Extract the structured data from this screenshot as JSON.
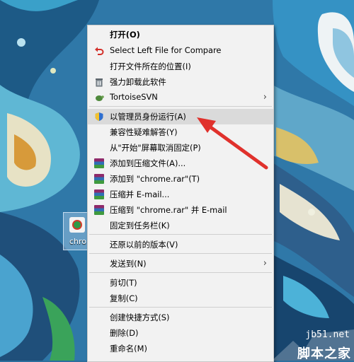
{
  "desktop": {
    "icon_label": "chro"
  },
  "menu": {
    "items": [
      {
        "label": "打开(O)",
        "icon": "none"
      },
      {
        "label": "Select Left File for Compare",
        "icon": "undo-arrow-icon"
      },
      {
        "label": "打开文件所在的位置(I)",
        "icon": "none"
      },
      {
        "label": "强力卸载此软件",
        "icon": "trash-icon"
      },
      {
        "label": "TortoiseSVN",
        "icon": "tortoise-icon",
        "submenu": true
      },
      {
        "label": "以管理员身份运行(A)",
        "icon": "uac-shield-icon"
      },
      {
        "label": "兼容性疑难解答(Y)",
        "icon": "none"
      },
      {
        "label": "从\"开始\"屏幕取消固定(P)",
        "icon": "none"
      },
      {
        "label": "添加到压缩文件(A)...",
        "icon": "winrar-icon"
      },
      {
        "label": "添加到 \"chrome.rar\"(T)",
        "icon": "winrar-icon"
      },
      {
        "label": "压缩并 E-mail...",
        "icon": "winrar-icon"
      },
      {
        "label": "压缩到 \"chrome.rar\" 并 E-mail",
        "icon": "winrar-icon"
      },
      {
        "label": "固定到任务栏(K)",
        "icon": "none"
      },
      {
        "label": "还原以前的版本(V)",
        "icon": "none"
      },
      {
        "label": "发送到(N)",
        "icon": "none",
        "submenu": true
      },
      {
        "label": "剪切(T)",
        "icon": "none"
      },
      {
        "label": "复制(C)",
        "icon": "none"
      },
      {
        "label": "创建快捷方式(S)",
        "icon": "none"
      },
      {
        "label": "删除(D)",
        "icon": "none"
      },
      {
        "label": "重命名(M)",
        "icon": "none"
      }
    ],
    "highlighted": "以管理员身份运行(A)"
  },
  "watermark": {
    "site": "jb51.net",
    "name": "脚本之家"
  },
  "colors": {
    "annotation_arrow": "#e0312c",
    "menu_bg": "#f2f2f2",
    "highlight": "#dadada"
  }
}
